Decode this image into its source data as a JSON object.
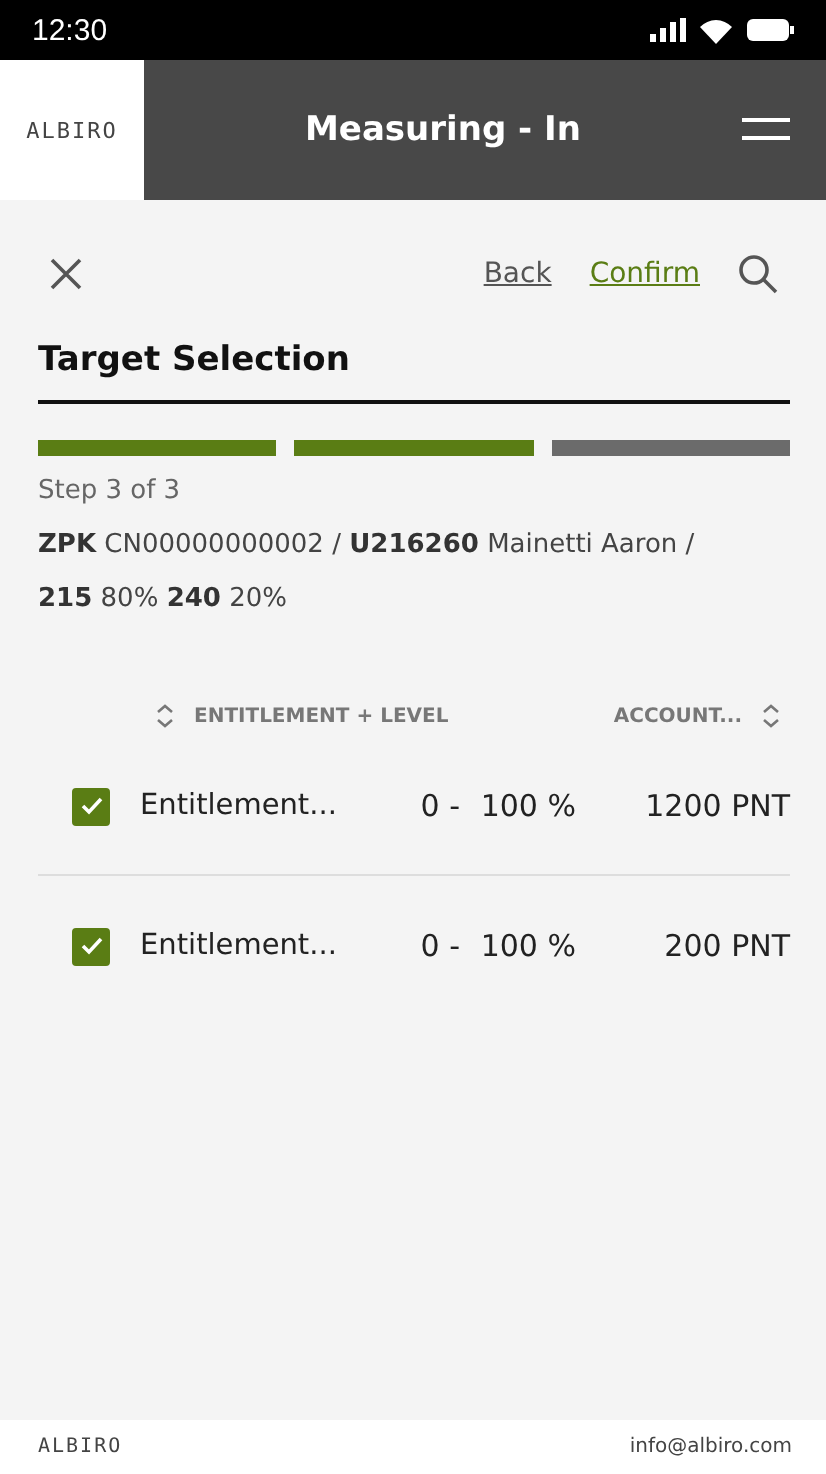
{
  "status_bar": {
    "time": "12:30"
  },
  "header": {
    "logo": "ALBIRO",
    "title": "Measuring - In"
  },
  "toolbar": {
    "links": [
      {
        "label": "Back",
        "kind": "back"
      },
      {
        "label": "Confirm",
        "kind": "confirm"
      }
    ]
  },
  "page_title": "Target Selection",
  "progress": {
    "segments": [
      {
        "done": true
      },
      {
        "done": true
      },
      {
        "done": false
      }
    ],
    "label": "Step 3 of 3"
  },
  "details": [
    "**ZPK** CN00000000002  /  **U216260** Mainetti Aaron  /",
    "**215** 80%   **240** 20%"
  ],
  "table": {
    "columns": [
      "ENTITLEMENT + LEVEL",
      "ACCOUNT..."
    ],
    "rows": [
      {
        "checked": true,
        "name": "Entitlement...",
        "range_from": "0 -",
        "range_to": "100 %",
        "amount": "1200 PNT"
      },
      {
        "checked": true,
        "name": "Entitlement...",
        "range_from": "0 -",
        "range_to": "100 %",
        "amount": "200 PNT"
      }
    ]
  },
  "footer": {
    "logo": "ALBIRO",
    "email": "info@albiro.com"
  }
}
